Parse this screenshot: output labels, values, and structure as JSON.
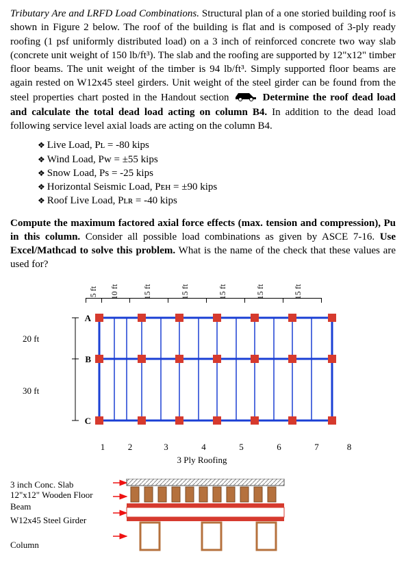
{
  "intro": {
    "title": "Tributary Are and LRFD Load Combinations.",
    "body": "Structural plan of a one storied building roof is shown in Figure 2 below. The roof of the building is flat and is composed of 3-ply ready roofing (1 psf uniformly distributed load) on a 3 inch of reinforced concrete two way slab (concrete unit weight of 150 lb/ft³). The slab and the roofing are supported by 12\"x12\" timber floor beams. The unit weight of the timber is 94 lb/ft³. Simply supported floor beams are again rested on W12x45 steel girders. Unit weight of the steel girder can be found from the steel properties chart posted in the Handout section",
    "bold_tail": "Determine the roof dead load and calculate the total dead load acting on column B4.",
    "after": "In addition to the dead load following service level axial loads are acting on the column B4."
  },
  "loads": [
    "Live Load, Pʟ = -80 kips",
    "Wind Load, Pw = ±55 kips",
    "Snow Load, Ps = -25 kips",
    "Horizontal Seismic Load, Pᴇʜ = ±90 kips",
    "Roof Live Load, Pʟʀ = -40 kips"
  ],
  "task": {
    "p1_bold": "Compute the maximum factored axial force effects (max. tension and compression), Pu in this column.",
    "p1_rest": "Consider all possible load combinations as given by ASCE 7-16.",
    "p2_bold": "Use Excel/Mathcad to solve this problem.",
    "p2_rest": "What is the name of the check that these values are used for?"
  },
  "plan": {
    "spacings": [
      "5 ft",
      "10 ft",
      "15 ft",
      "15 ft",
      "15 ft",
      "15 ft",
      "15 ft"
    ],
    "row_labels": [
      "A",
      "B",
      "C"
    ],
    "vdims": [
      "20 ft",
      "30 ft"
    ],
    "col_numbers": [
      "1",
      "2",
      "3",
      "4",
      "5",
      "6",
      "7",
      "8"
    ],
    "caption": "3 Ply Roofing"
  },
  "section": {
    "labels": [
      "3 inch Conc. Slab",
      "12\"x12\" Wooden Floor Beam",
      "W12x45 Steel Girder",
      "Column"
    ]
  }
}
